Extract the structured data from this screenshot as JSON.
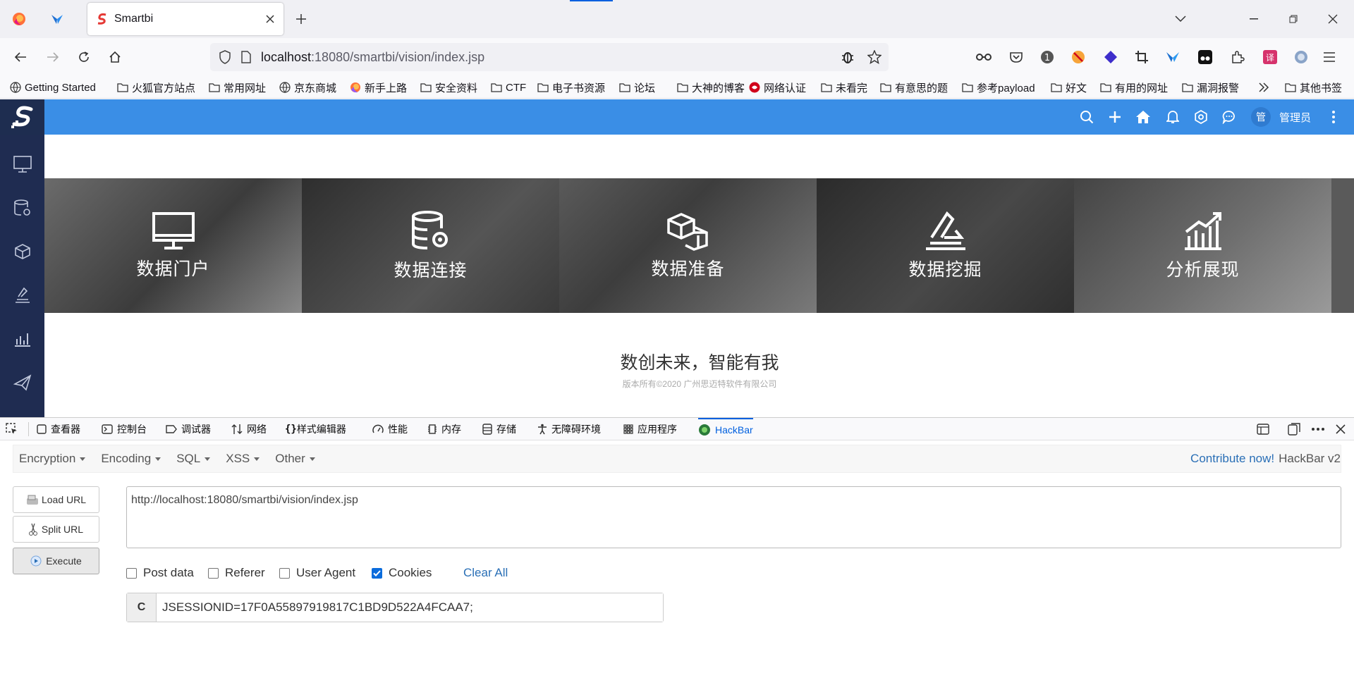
{
  "browser": {
    "tab": {
      "title": "Smartbi"
    },
    "url": {
      "host": "localhost",
      "rest": ":18080/smartbi/vision/index.jsp"
    }
  },
  "bookmarks": [
    {
      "label": "Getting Started",
      "icon": "globe-icon"
    },
    {
      "label": "火狐官方站点",
      "icon": "folder-icon"
    },
    {
      "label": "常用网址",
      "icon": "folder-icon"
    },
    {
      "label": "京东商城",
      "icon": "globe-icon"
    },
    {
      "label": "新手上路",
      "icon": "firefox-icon"
    },
    {
      "label": "安全资料",
      "icon": "folder-icon"
    },
    {
      "label": "CTF",
      "icon": "folder-icon"
    },
    {
      "label": "电子书资源",
      "icon": "folder-icon"
    },
    {
      "label": "论坛",
      "icon": "folder-icon"
    },
    {
      "label": "大神的博客",
      "icon": "folder-icon"
    },
    {
      "label": "网络认证",
      "icon": "network-icon"
    },
    {
      "label": "未看完",
      "icon": "folder-icon"
    },
    {
      "label": "有意思的题",
      "icon": "folder-icon"
    },
    {
      "label": "参考payload",
      "icon": "folder-icon"
    },
    {
      "label": "好文",
      "icon": "folder-icon"
    },
    {
      "label": "有用的网址",
      "icon": "folder-icon"
    },
    {
      "label": "漏洞报警",
      "icon": "folder-icon"
    }
  ],
  "bookmarks_more": "其他书签",
  "app": {
    "topbar": {
      "avatar": "管",
      "user": "管理员"
    },
    "panels": [
      {
        "label": "数据门户",
        "icon": "monitor-icon"
      },
      {
        "label": "数据连接",
        "icon": "database-gear-icon"
      },
      {
        "label": "数据准备",
        "icon": "cubes-icon"
      },
      {
        "label": "数据挖掘",
        "icon": "mining-icon"
      },
      {
        "label": "分析展现",
        "icon": "bar-chart-icon"
      }
    ],
    "slogan": "数创未来，智能有我",
    "copyright": "版本所有©2020 广州思迈特软件有限公司"
  },
  "devtools": {
    "tabs": [
      {
        "label": "查看器"
      },
      {
        "label": "控制台"
      },
      {
        "label": "调试器"
      },
      {
        "label": "网络"
      },
      {
        "label": "样式编辑器"
      },
      {
        "label": "性能"
      },
      {
        "label": "内存"
      },
      {
        "label": "存储"
      },
      {
        "label": "无障碍环境"
      },
      {
        "label": "应用程序"
      },
      {
        "label": "HackBar"
      }
    ]
  },
  "hackbar": {
    "menus": [
      "Encryption",
      "Encoding",
      "SQL",
      "XSS",
      "Other"
    ],
    "contribute": "Contribute now!",
    "version": "HackBar v2",
    "buttons": {
      "load": "Load URL",
      "split": "Split URL",
      "execute": "Execute"
    },
    "url_value": "http://localhost:18080/smartbi/vision/index.jsp",
    "checkboxes": [
      {
        "label": "Post data",
        "checked": false
      },
      {
        "label": "Referer",
        "checked": false
      },
      {
        "label": "User Agent",
        "checked": false
      },
      {
        "label": "Cookies",
        "checked": true
      }
    ],
    "clear_all": "Clear All",
    "cookie_prefix": "C",
    "cookie_value": "JSESSIONID=17F0A55897919817C1BD9D522A4FCAA7;"
  },
  "colors": {
    "app_blue": "#3a8ee6",
    "sidebar": "#1f2c51",
    "hackbar_link": "#2a6fb6"
  }
}
